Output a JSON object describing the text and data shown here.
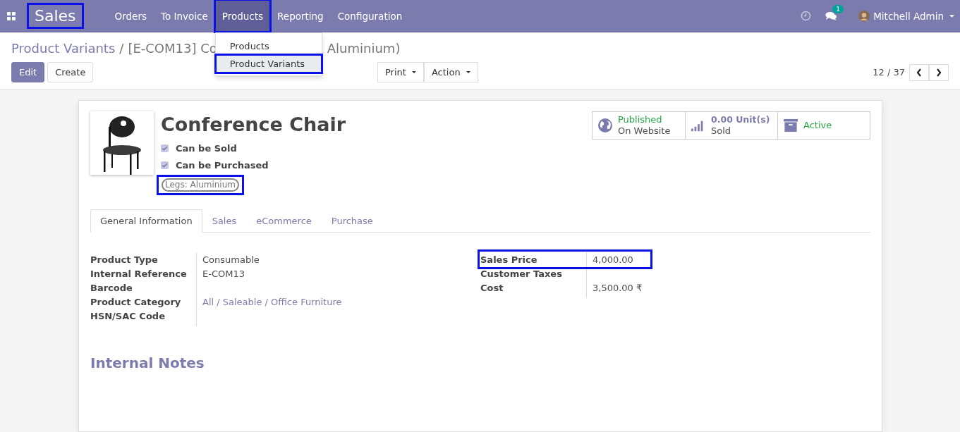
{
  "navbar": {
    "app_name": {
      "label": "Sales",
      "highlighted": true
    },
    "menus": [
      {
        "label": "Orders",
        "selected": false,
        "highlighted": false
      },
      {
        "label": "To Invoice",
        "selected": false,
        "highlighted": false
      },
      {
        "label": "Products",
        "selected": true,
        "highlighted": true,
        "dropdown": [
          {
            "label": "Products",
            "selected": false,
            "highlighted": false
          },
          {
            "label": "Product Variants",
            "selected": true,
            "highlighted": true
          }
        ]
      },
      {
        "label": "Reporting",
        "selected": false,
        "highlighted": false
      },
      {
        "label": "Configuration",
        "selected": false,
        "highlighted": false
      }
    ],
    "messages_count": "1",
    "user": "Mitchell Admin"
  },
  "breadcrumb": {
    "parent": "Product Variants",
    "separator": "/",
    "current_start": "[E-COM13] Co",
    "current_end": "Aluminium)"
  },
  "buttons": {
    "edit": "Edit",
    "create": "Create"
  },
  "actions": [
    "Print",
    "Action"
  ],
  "pager": "12 / 37",
  "product": {
    "name": "Conference Chair",
    "options": [
      {
        "label": "Can be Sold",
        "checked": true
      },
      {
        "label": "Can be Purchased",
        "checked": true
      }
    ],
    "attribute": {
      "label": "Legs: Aluminium",
      "highlighted": true
    }
  },
  "smart_buttons": [
    {
      "kind": "website",
      "line1": "Published",
      "line2": "On Website"
    },
    {
      "kind": "sold",
      "value": "0.00",
      "unit": "Unit(s)",
      "line2": "Sold"
    },
    {
      "kind": "active",
      "line1": "Active"
    }
  ],
  "tabs": [
    {
      "label": "General Information",
      "selected": true
    },
    {
      "label": "Sales",
      "selected": false
    },
    {
      "label": "eCommerce",
      "selected": false
    },
    {
      "label": "Purchase",
      "selected": false
    }
  ],
  "left_fields": [
    {
      "label": "Product Type",
      "value": "Consumable",
      "kind": "text"
    },
    {
      "label": "Internal Reference",
      "value": "E-COM13",
      "kind": "text"
    },
    {
      "label": "Barcode"
    },
    {
      "label": "Product Category",
      "value": "All / Saleable / Office Furniture",
      "kind": "link"
    },
    {
      "label": "HSN/SAC Code"
    }
  ],
  "right_fields": [
    {
      "label": "Sales Price",
      "value": "4,000.00",
      "highlighted": true
    },
    {
      "label": "Customer Taxes"
    },
    {
      "label": "Cost",
      "value": "3,500.00 ₹"
    }
  ],
  "notes_title": "Internal Notes"
}
